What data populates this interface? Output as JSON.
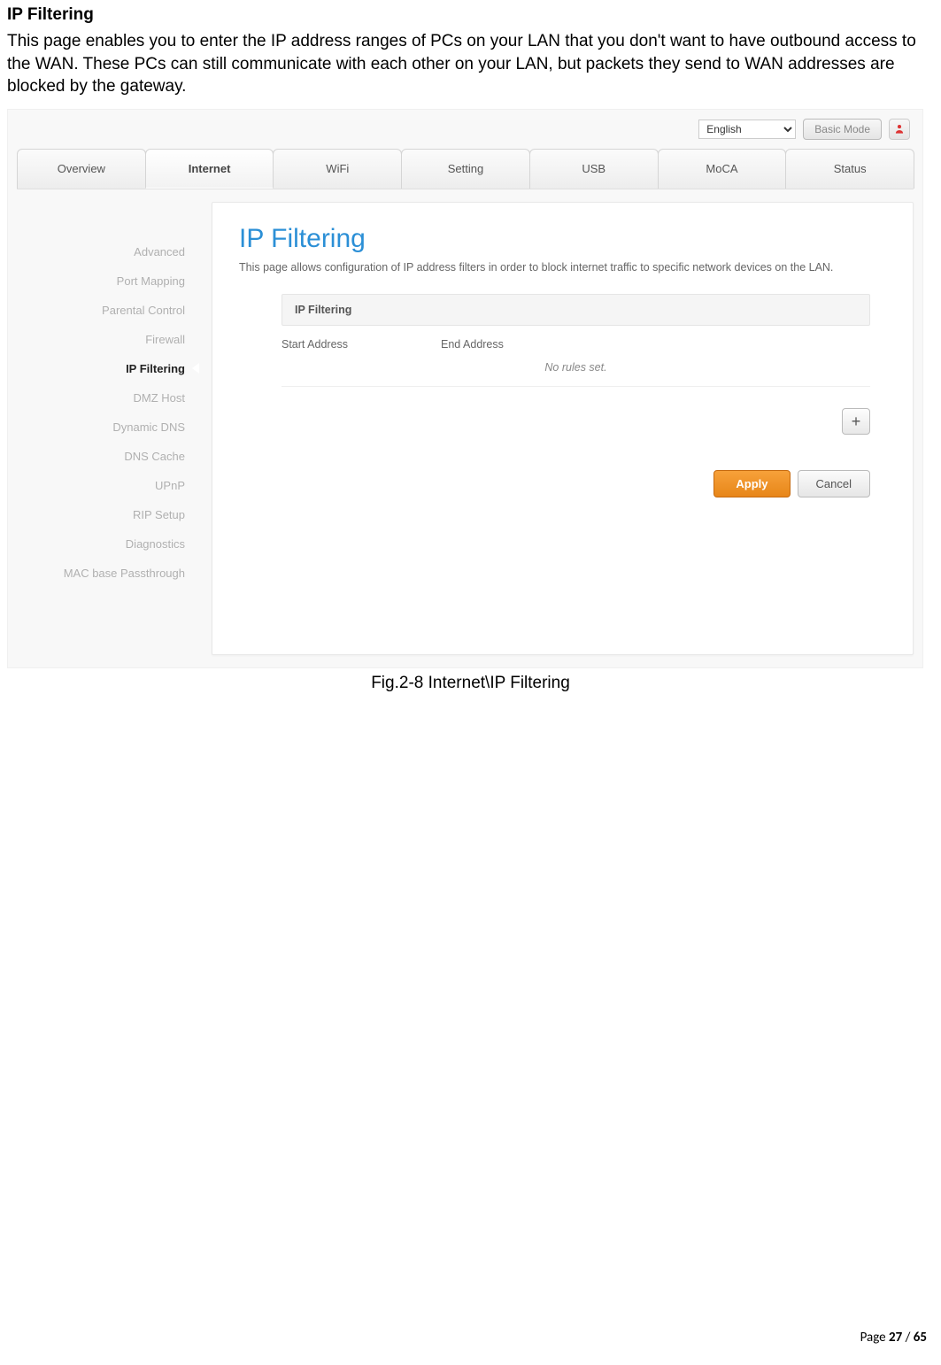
{
  "doc": {
    "heading": "IP Filtering",
    "paragraph": "This page enables you to enter the IP address ranges of PCs on your LAN that you don't want to have outbound access to the WAN. These PCs can still communicate with each other on your LAN, but packets they send to WAN addresses are blocked by the gateway.",
    "caption": "Fig.2-8 Internet\\IP Filtering"
  },
  "topbar": {
    "lang_selected": "English",
    "basic_mode": "Basic Mode"
  },
  "tabs": [
    "Overview",
    "Internet",
    "WiFi",
    "Setting",
    "USB",
    "MoCA",
    "Status"
  ],
  "active_tab_index": 1,
  "sidebar": {
    "items": [
      "Advanced",
      "Port Mapping",
      "Parental Control",
      "Firewall",
      "IP Filtering",
      "DMZ Host",
      "Dynamic DNS",
      "DNS Cache",
      "UPnP",
      "RIP Setup",
      "Diagnostics",
      "MAC base Passthrough"
    ],
    "active_index": 4
  },
  "panel": {
    "title": "IP Filtering",
    "desc": "This page allows configuration of IP address filters in order to block internet traffic to specific network devices on the LAN.",
    "section": "IP Filtering",
    "col_start": "Start Address",
    "col_end": "End Address",
    "no_rules": "No rules set.",
    "add": "+",
    "apply": "Apply",
    "cancel": "Cancel"
  },
  "footer": {
    "prefix": "Page ",
    "current": "27",
    "sep": " / ",
    "total": "65"
  }
}
